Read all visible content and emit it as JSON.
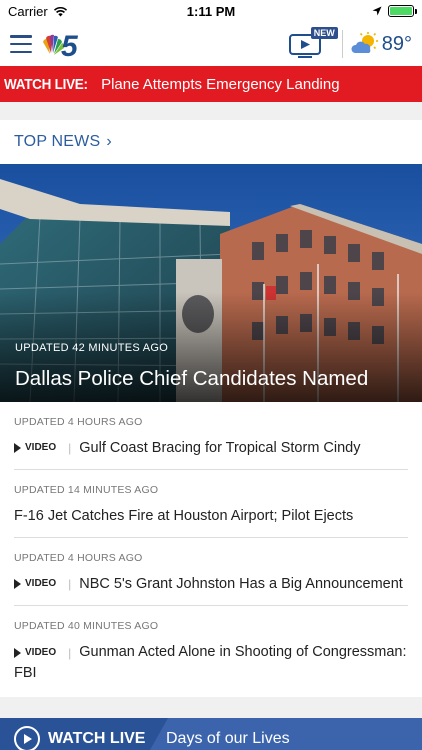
{
  "status_bar": {
    "carrier": "Carrier",
    "time": "1:11 PM",
    "battery_level": 1.0
  },
  "header": {
    "menu_icon": "hamburger-menu-icon",
    "logo_icon": "nbc5-peacock-logo",
    "tv_badge": "NEW",
    "temperature": "89°",
    "weather_icon": "partly-sunny-icon",
    "accent": "#1f4e8c"
  },
  "live_banner": {
    "tag": "WATCH LIVE:",
    "text": "Plane Attempts Emergency Landing",
    "color": "#e21b22"
  },
  "top_news": {
    "title": "TOP NEWS",
    "hero": {
      "updated": "UPDATED 42 MINUTES AGO",
      "headline": "Dallas Police Chief Candidates Named"
    },
    "stories": [
      {
        "updated": "UPDATED 4 HOURS AGO",
        "video": true,
        "video_label": "VIDEO",
        "headline": "Gulf Coast Bracing for Tropical Storm Cindy"
      },
      {
        "updated": "UPDATED 14 MINUTES AGO",
        "video": false,
        "video_label": "",
        "headline": "F-16 Jet Catches Fire at Houston Airport; Pilot Ejects"
      },
      {
        "updated": "UPDATED 4 HOURS AGO",
        "video": true,
        "video_label": "VIDEO",
        "headline": "NBC 5's Grant Johnston Has a Big Announcement"
      },
      {
        "updated": "UPDATED 40 MINUTES AGO",
        "video": true,
        "video_label": "VIDEO",
        "headline": "Gunman Acted Alone in Shooting of Congressman: FBI"
      }
    ]
  },
  "bottom_bar": {
    "watch_live": "WATCH LIVE",
    "now_playing": "Days of our Lives",
    "color": "#2a5296"
  }
}
